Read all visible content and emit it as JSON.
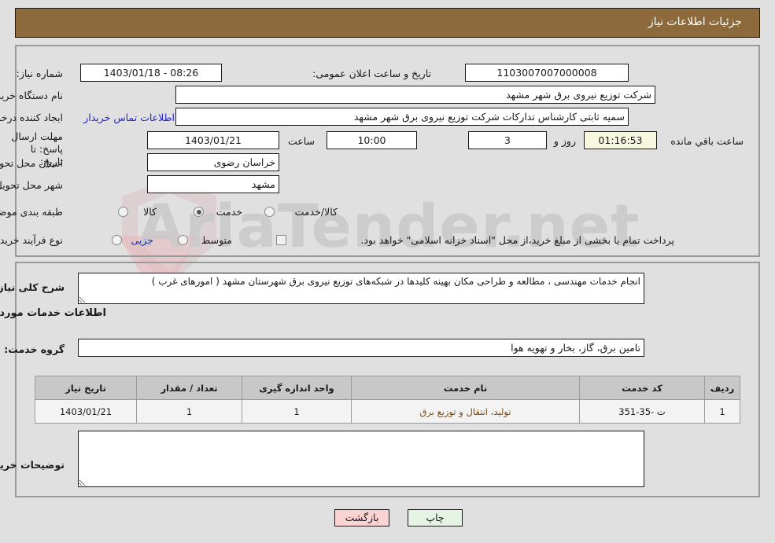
{
  "header": {
    "title": "جزئیات اطلاعات نیاز"
  },
  "need_info": {
    "need_number_label": "شماره نیاز:",
    "need_number_value": "1103007007000008",
    "announce_datetime_label": "تاریخ و ساعت اعلان عمومی:",
    "announce_datetime_value": "1403/01/18 - 08:26",
    "buyer_org_label": "نام دستگاه خریدار:",
    "buyer_org_value": "شرکت توزیع نیروی برق شهر مشهد",
    "requester_label": "ایجاد کننده درخواست:",
    "requester_value": "سمیه ثابتی کارشناس تدارکات شرکت توزیع نیروی برق شهر مشهد",
    "buyer_contact_link": "اطلاعات تماس خریدار",
    "deadline_label": "مهلت ارسال پاسخ: تا تاریخ:",
    "deadline_date": "1403/01/21",
    "deadline_time_label": "ساعت",
    "deadline_time": "10:00",
    "days_remaining": "3",
    "days_label": "روز و",
    "countdown": "01:16:53",
    "countdown_label": "ساعت باقي مانده",
    "province_label": "استان محل تحویل:",
    "province_value": "خراسان رضوی",
    "city_label": "شهر محل تحویل:",
    "city_value": "مشهد",
    "category_label": "طبقه بندی موضوعی:",
    "category_options": [
      {
        "label": "کالا",
        "selected": false
      },
      {
        "label": "خدمت",
        "selected": true
      },
      {
        "label": "کالا/خدمت",
        "selected": false
      }
    ],
    "purchase_type_label": "نوع فرآیند خرید :",
    "purchase_type_options": [
      {
        "label": "جزیی",
        "selected": false
      },
      {
        "label": "متوسط",
        "selected": false
      }
    ],
    "treasury_checkbox_label": "پرداخت تمام یا بخشی از مبلغ خرید،از محل \"اسناد خزانه اسلامی\" خواهد بود.",
    "treasury_checked": false
  },
  "description": {
    "general_label": "شرح کلی نیاز:",
    "general_value": "انجام خدمات مهندسی ، مطالعه و طراحی مکان بهینه کلیدها در شبکه‌های توزیع نیروی برق شهرستان مشهد ( امورهای غرب )",
    "services_heading": "اطلاعات خدمات مورد نیاز",
    "service_group_label": "گروه خدمت:",
    "service_group_value": "تامین برق، گاز، بخار و تهویه هوا"
  },
  "table": {
    "columns": [
      "ردیف",
      "کد خدمت",
      "نام خدمت",
      "واحد اندازه گیری",
      "تعداد / مقدار",
      "تاریخ نیاز"
    ],
    "rows": [
      {
        "row_no": "1",
        "service_code": "ت -35-351",
        "service_name": "تولید، انتقال و توزیع برق",
        "unit": "1",
        "quantity": "1",
        "need_date": "1403/01/21"
      }
    ]
  },
  "buyer_notes": {
    "label": "توضیحات خریدار:",
    "value": ""
  },
  "buttons": {
    "print": "چاپ",
    "back": "بازگشت"
  },
  "colors": {
    "header_bar": "#8c6a3c",
    "page_bg": "#e0e0e0",
    "link": "#2222cc",
    "print_btn": "#e6f4e6",
    "back_btn": "#fbd3d3",
    "table_header": "#c8c8c8"
  },
  "watermark": {
    "text": "AriaTender.net"
  }
}
